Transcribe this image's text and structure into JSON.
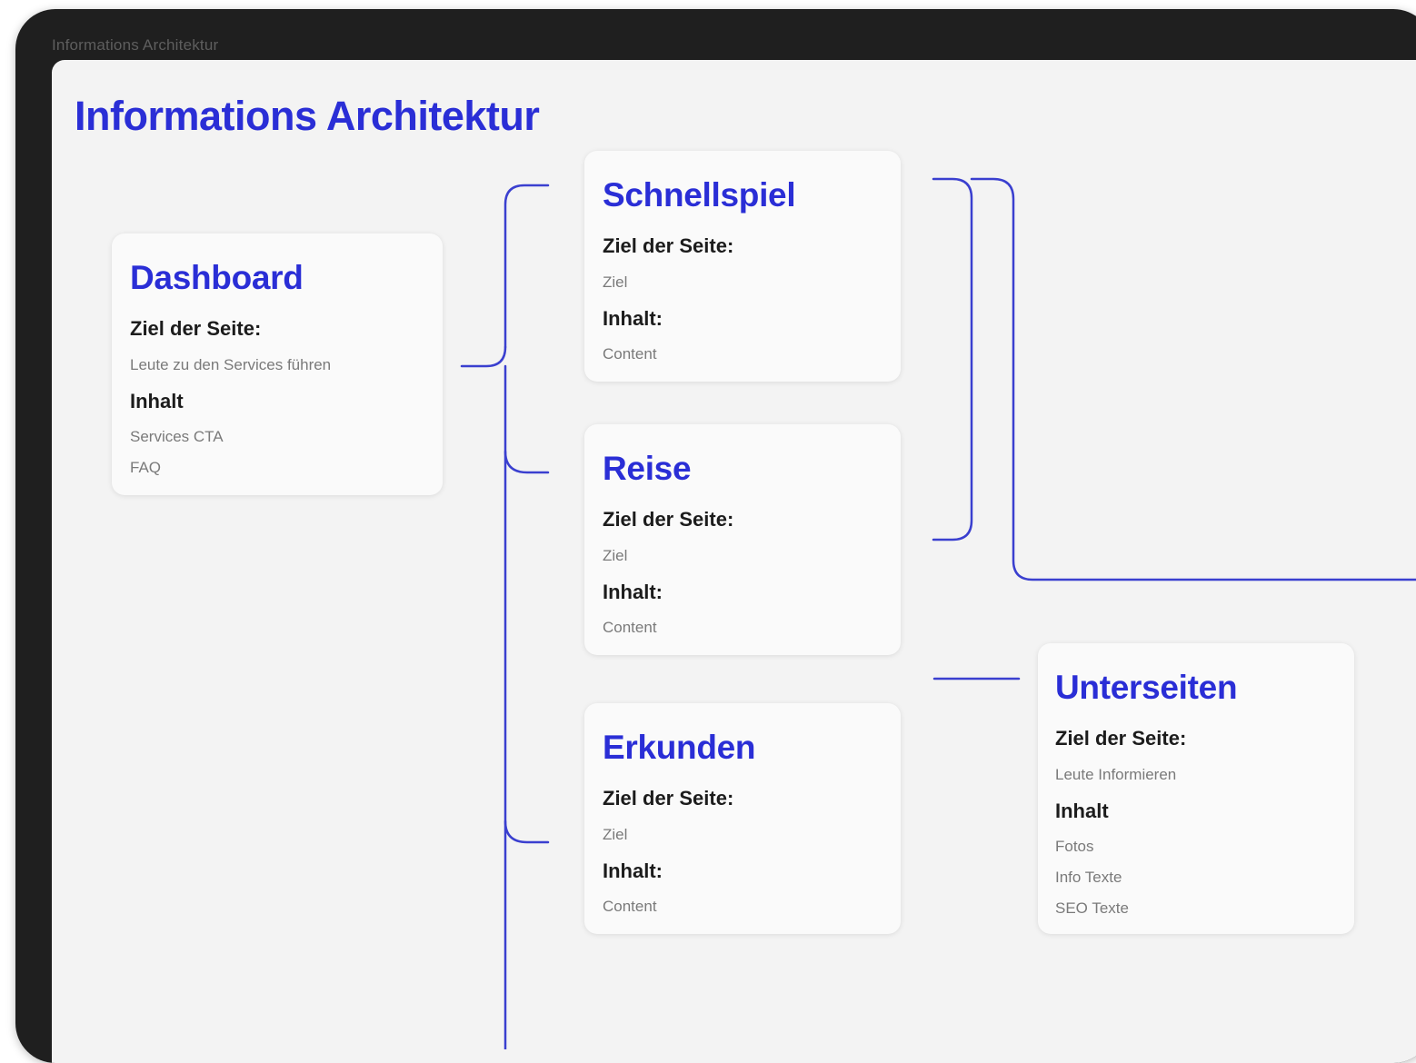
{
  "frame": {
    "label": "Informations Architektur"
  },
  "page": {
    "title": "Informations Architektur"
  },
  "cards": {
    "dashboard": {
      "title": "Dashboard",
      "goal_label": "Ziel der Seite:",
      "goal_value": "Leute zu den Services führen",
      "content_label": "Inhalt",
      "content_items": [
        "Services CTA",
        "FAQ"
      ]
    },
    "schnellspiel": {
      "title": "Schnellspiel",
      "goal_label": "Ziel der Seite:",
      "goal_value": "Ziel",
      "content_label": "Inhalt:",
      "content_items": [
        "Content"
      ]
    },
    "reise": {
      "title": "Reise",
      "goal_label": "Ziel der Seite:",
      "goal_value": "Ziel",
      "content_label": "Inhalt:",
      "content_items": [
        "Content"
      ]
    },
    "erkunden": {
      "title": "Erkunden",
      "goal_label": "Ziel der Seite:",
      "goal_value": "Ziel",
      "content_label": "Inhalt:",
      "content_items": [
        "Content"
      ]
    },
    "unterseiten": {
      "title": "Unterseiten",
      "goal_label": "Ziel der Seite:",
      "goal_value": "Leute Informieren",
      "content_label": "Inhalt",
      "content_items": [
        "Fotos",
        "Info Texte",
        "SEO Texte"
      ]
    }
  },
  "colors": {
    "accent": "#2a2ed6",
    "connector": "#3a3fcf",
    "frame": "#1f1f1f",
    "canvas": "#f3f3f3",
    "card": "#fafafa"
  }
}
